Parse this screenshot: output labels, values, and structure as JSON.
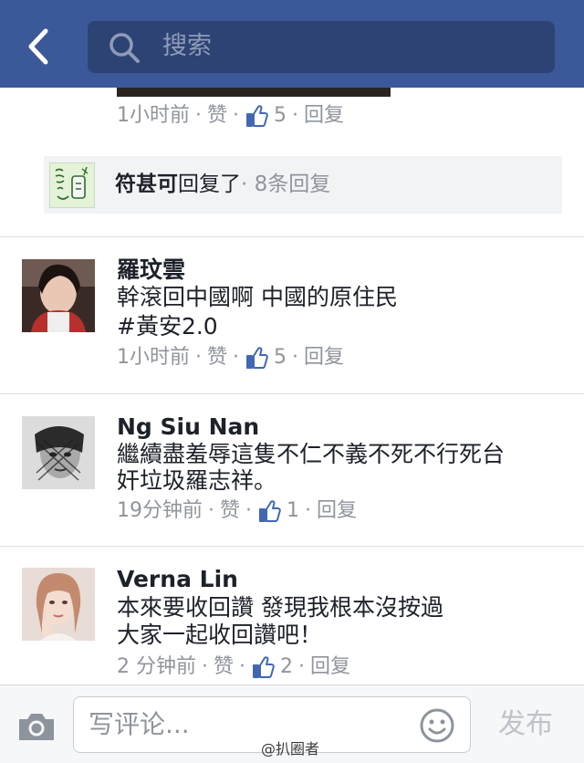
{
  "header": {
    "search_placeholder": "搜索"
  },
  "previous_comment": {
    "time": "1小时前",
    "like": "赞",
    "likes": "5",
    "reply": "回复"
  },
  "replies_summary": {
    "name": "符甚可",
    "action": "回复了",
    "count": "· 8条回复"
  },
  "comments": [
    {
      "author": "羅玟雲",
      "lines": [
        "幹滾回中國啊 中國的原住民",
        "#黃安2.0"
      ],
      "time": "1小时前",
      "like": "赞",
      "likes": "5",
      "reply": "回复"
    },
    {
      "author": "Ng Siu Nan",
      "lines": [
        "繼續盡羞辱這隻不仁不義不死不行死台",
        "奸垃圾羅志祥。"
      ],
      "time": "19分钟前",
      "like": "赞",
      "likes": "1",
      "reply": "回复"
    },
    {
      "author": "Verna Lin",
      "lines": [
        "本來要收回讚 發現我根本沒按過",
        "大家一起收回讚吧！"
      ],
      "time": "2 分钟前",
      "like": "赞",
      "likes": "2",
      "reply": "回复"
    }
  ],
  "composer": {
    "placeholder": "写评论...",
    "post_label": "发布"
  },
  "watermark": "@扒圈者",
  "colors": {
    "header_bg": "#3b5998",
    "search_bg": "#2d4373",
    "meta_text": "#90949c",
    "like_icon": "#4267b2"
  },
  "icons": [
    "back-chevron-icon",
    "search-icon",
    "thumbs-up-icon",
    "camera-icon",
    "smiley-icon"
  ]
}
